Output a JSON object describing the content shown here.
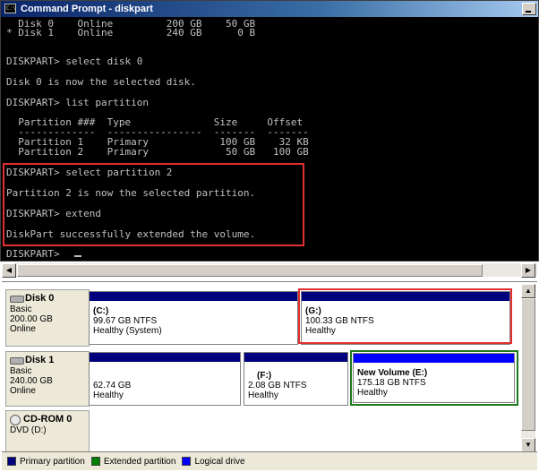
{
  "window": {
    "title": "Command Prompt - diskpart",
    "icon": "cmd-icon",
    "icon_text": "C:\\"
  },
  "console": {
    "lines": [
      "  Disk 0    Online         200 GB    50 GB",
      "* Disk 1    Online         240 GB      0 B",
      "",
      "DISKPART> select disk 0",
      "",
      "Disk 0 is now the selected disk.",
      "",
      "DISKPART> list partition",
      "",
      "  Partition ###  Type              Size     Offset",
      "  -------------  ----------------  -------  -------",
      "  Partition 1    Primary            100 GB    32 KB",
      "  Partition 2    Primary             50 GB   100 GB",
      "",
      "DISKPART> select partition 2",
      "",
      "Partition 2 is now the selected partition.",
      "",
      "DISKPART> extend",
      "",
      "DiskPart successfully extended the volume.",
      "",
      "DISKPART> "
    ]
  },
  "disks": [
    {
      "name": "Disk 0",
      "type": "Basic",
      "size": "200.00 GB",
      "status": "Online",
      "icon": "hard-disk-icon",
      "partitions": [
        {
          "title": "(C:)",
          "size": "99.67 GB NTFS",
          "status": "Healthy (System)"
        },
        {
          "title": "(G:)",
          "size": "100.33 GB NTFS",
          "status": "Healthy"
        }
      ]
    },
    {
      "name": "Disk 1",
      "type": "Basic",
      "size": "240.00 GB",
      "status": "Online",
      "icon": "hard-disk-icon",
      "partitions": [
        {
          "title": "",
          "size": "62.74 GB",
          "status": "Healthy"
        },
        {
          "title": "(F:)",
          "size": "2.08 GB NTFS",
          "status": "Healthy"
        },
        {
          "title": "New Volume  (E:)",
          "size": "175.18 GB NTFS",
          "status": "Healthy"
        }
      ]
    },
    {
      "name": "CD-ROM 0",
      "type": "DVD (D:)",
      "icon": "cd-rom-icon"
    }
  ],
  "legend": [
    {
      "label": "Primary partition",
      "color": "#00007f"
    },
    {
      "label": "Extended partition",
      "color": "#008000"
    },
    {
      "label": "Logical drive",
      "color": "#0000ff"
    }
  ],
  "colors": {
    "primary_bar": "#00007f",
    "logical_bar": "#0000ff",
    "highlight_red": "#e03030",
    "highlight_green": "#1c7a1c"
  }
}
